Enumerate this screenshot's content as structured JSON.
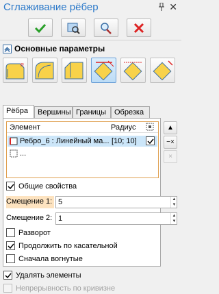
{
  "window": {
    "title": "Сглаживание рёбер"
  },
  "toolbar": {
    "ok": "check-icon",
    "preview": "preview-icon",
    "zoom": "zoom-icon",
    "cancel": "x-icon"
  },
  "section": {
    "label": "Основные параметры"
  },
  "tabs": [
    {
      "label": "Рёбра"
    },
    {
      "label": "Вершины"
    },
    {
      "label": "Границы"
    },
    {
      "label": "Обрезка"
    }
  ],
  "grid": {
    "col_element": "Элемент",
    "col_radius": "Радиус",
    "rows": [
      {
        "element": "Ребро_6 : Линейный ма...",
        "radius": "[10; 10]",
        "checked": true
      },
      {
        "element": "..."
      }
    ]
  },
  "side_buttons": {
    "up": "▲",
    "remove": "−×",
    "delete": "×"
  },
  "general": {
    "label": "Общие свойства",
    "checked": true
  },
  "offset1": {
    "label": "Смещение 1:",
    "value": "5"
  },
  "offset2": {
    "label": "Смещение 2:",
    "value": "1"
  },
  "options": [
    {
      "label": "Разворот",
      "checked": false
    },
    {
      "label": "Продолжить по касательной",
      "checked": true
    },
    {
      "label": "Сначала вогнутые",
      "checked": false
    }
  ],
  "footer": [
    {
      "label": "Удалять элементы",
      "checked": true,
      "disabled": false
    },
    {
      "label": "Непрерывность по кривизне",
      "checked": false,
      "disabled": true
    }
  ],
  "colors": {
    "accent": "#2a78c9",
    "highlight": "#fde3c0",
    "selection": "#cce6f9",
    "grid_border": "#e0a050"
  }
}
